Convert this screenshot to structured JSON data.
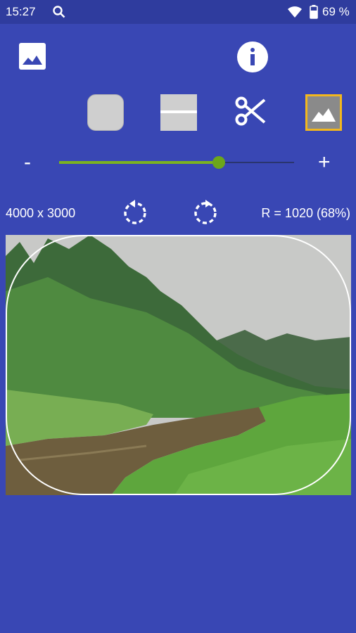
{
  "status_bar": {
    "time": "15:27",
    "battery": "69 %",
    "icons": [
      "search-icon",
      "moon-icon",
      "wifi-icon",
      "battery-icon"
    ]
  },
  "toolbar": {
    "icons": [
      "image-gallery-icon",
      "info-icon",
      "night-mode-moon-icon"
    ]
  },
  "shape_tools": {
    "icons": [
      "rounded-square-shape",
      "horizontal-line-shape",
      "scissors-icon",
      "image-mode-icon"
    ],
    "selected": "image-mode-icon",
    "accent_color": "#f2b71e"
  },
  "zoom": {
    "minus_label": "-",
    "plus_label": "+",
    "level": 0.68,
    "track_fill_color": "#7bb31e"
  },
  "info_row": {
    "dimensions": "4000 x 3000",
    "radius_text": "R = 1020 (68%)",
    "icons": [
      "rotate-left-icon",
      "rotate-right-icon"
    ]
  },
  "colors": {
    "background": "#3947b4",
    "status_bar": "#2f3c9e"
  }
}
